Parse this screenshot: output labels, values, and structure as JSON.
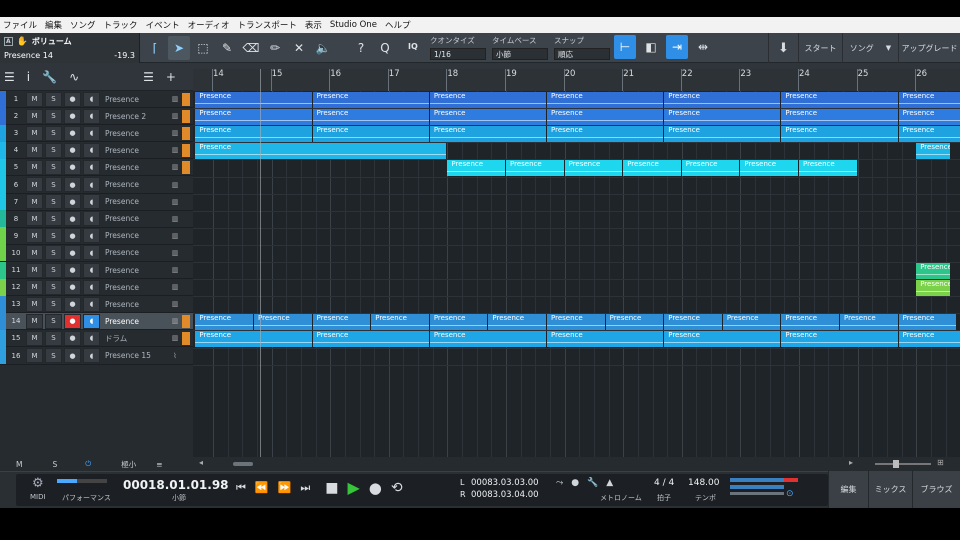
{
  "menu": [
    "ファイル",
    "編集",
    "ソング",
    "トラック",
    "イベント",
    "オーディオ",
    "トランスポート",
    "表示",
    "Studio One",
    "ヘルプ"
  ],
  "inspector": {
    "label": "ボリューム",
    "track": "Presence 14",
    "value": "-19.3"
  },
  "quantize": {
    "label": "クオンタイズ",
    "value": "1/16"
  },
  "timebase": {
    "label": "タイムベース",
    "value": "小節"
  },
  "snap": {
    "label": "スナップ",
    "value": "順応"
  },
  "iq": "IQ",
  "nav": {
    "start": "スタート",
    "song": "ソング",
    "upgrade": "アップグレード"
  },
  "ruler": [
    "14",
    "15",
    "16",
    "17",
    "18",
    "19",
    "20",
    "21",
    "22",
    "23",
    "24",
    "25",
    "26"
  ],
  "track_buttons": {
    "mute": "M",
    "solo": "S"
  },
  "tracks": [
    {
      "num": "1",
      "name": "Presence",
      "color": "#2f6fd6"
    },
    {
      "num": "2",
      "name": "Presence 2",
      "color": "#2f6fd6"
    },
    {
      "num": "3",
      "name": "Presence",
      "color": "#1fa3e0"
    },
    {
      "num": "4",
      "name": "Presence",
      "color": "#1fb7e8"
    },
    {
      "num": "5",
      "name": "Presence",
      "color": "#1fc6e6"
    },
    {
      "num": "6",
      "name": "Presence",
      "color": "#1fc6e6"
    },
    {
      "num": "7",
      "name": "Presence",
      "color": "#1fc6e6"
    },
    {
      "num": "8",
      "name": "Presence",
      "color": "#24b89a"
    },
    {
      "num": "9",
      "name": "Presence",
      "color": "#6fd24a"
    },
    {
      "num": "10",
      "name": "Presence",
      "color": "#6fd24a"
    },
    {
      "num": "11",
      "name": "Presence",
      "color": "#2cc58a"
    },
    {
      "num": "12",
      "name": "Presence",
      "color": "#7bd24a"
    },
    {
      "num": "13",
      "name": "Presence",
      "color": "#2f8fd6"
    },
    {
      "num": "14",
      "name": "Presence",
      "color": "#2f8fd6"
    },
    {
      "num": "15",
      "name": "ドラム",
      "color": "#2f9fe0"
    },
    {
      "num": "16",
      "name": "Presence 15",
      "color": "#2f9fe0"
    }
  ],
  "clip_label": "Presence",
  "bottom_left": {
    "m": "M",
    "s": "S",
    "zoom": "極小"
  },
  "transport": {
    "midi": "MIDI",
    "perf": "パフォーマンス",
    "time": "00018.01.01.98",
    "time_unit": "小節",
    "L": "L",
    "R": "R",
    "loop_l": "00083.03.03.00",
    "loop_r": "00083.03.04.00",
    "metronome": "メトロノーム",
    "sig": "4 / 4",
    "sig_label": "拍子",
    "tempo": "148.00",
    "tempo_label": "テンポ"
  },
  "views": {
    "edit": "編集",
    "mix": "ミックス",
    "browse": "ブラウズ"
  },
  "colors": {
    "accent": "#2f8fe6",
    "track_blue": "#2f6fd6",
    "track_cyan": "#1fc6e6",
    "record": "#e03030",
    "play": "#35c43a"
  }
}
